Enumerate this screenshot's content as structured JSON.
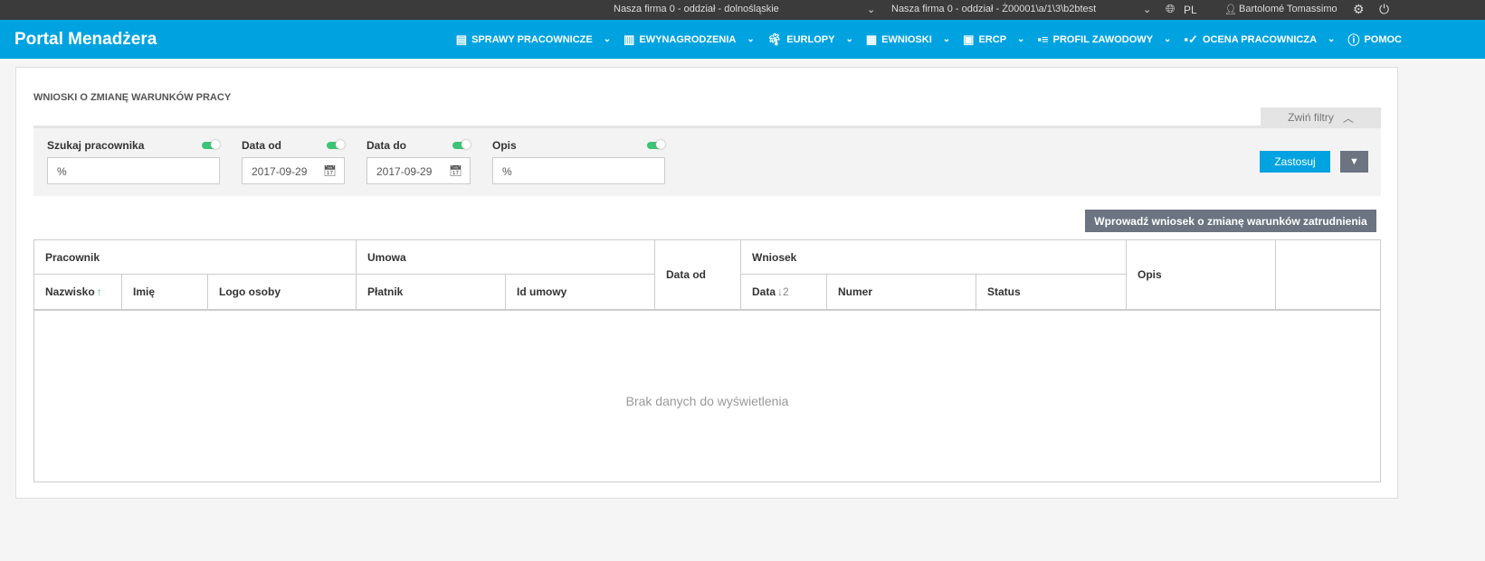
{
  "topbar": {
    "company1": "Nasza firma 0 - oddział - dolnośląskie",
    "company2": "Nasza firma 0 - oddział - Ż00001\\a/1\\3\\b2btest",
    "language": "PL",
    "user": "Bartolomé Tomassimo"
  },
  "nav": {
    "brand": "Portal Menadżera",
    "items": [
      {
        "label": "SPRAWY PRACOWNICZE",
        "icon": "document-icon"
      },
      {
        "label": "EWYNAGRODZENIA",
        "icon": "book-icon"
      },
      {
        "label": "EURLOPY",
        "icon": "palm-icon"
      },
      {
        "label": "EWNIOSKI",
        "icon": "clipboard-icon"
      },
      {
        "label": "ERCP",
        "icon": "calendar-icon"
      },
      {
        "label": "PROFIL ZAWODOWY",
        "icon": "profile-icon"
      },
      {
        "label": "OCENA PRACOWNICZA",
        "icon": "user-check-icon"
      },
      {
        "label": "POMOC",
        "icon": "help-icon"
      }
    ]
  },
  "page": {
    "title": "WNIOSKI O ZMIANĘ WARUNKÓW PRACY",
    "collapse_filters": "Zwiń filtry",
    "add_button": "Wprowadź wniosek o zmianę warunków zatrudnienia",
    "empty": "Brak danych do wyświetlenia"
  },
  "filters": {
    "employee": {
      "label": "Szukaj pracownika",
      "value": "%",
      "enabled": true
    },
    "date_from": {
      "label": "Data od",
      "value": "2017-09-29",
      "enabled": true
    },
    "date_to": {
      "label": "Data do",
      "value": "2017-09-29",
      "enabled": true
    },
    "desc": {
      "label": "Opis",
      "value": "%",
      "enabled": true
    },
    "apply": "Zastosuj"
  },
  "table": {
    "groups": {
      "employee": "Pracownik",
      "contract": "Umowa",
      "date_from": "Data od",
      "request": "Wniosek",
      "desc": "Opis"
    },
    "columns": {
      "surname": "Nazwisko",
      "name": "Imię",
      "logo": "Logo osoby",
      "payer": "Płatnik",
      "contract_id": "Id umowy",
      "date": "Data",
      "number": "Numer",
      "status": "Status"
    },
    "sort": {
      "surname": "↑",
      "date": "↓2"
    }
  }
}
